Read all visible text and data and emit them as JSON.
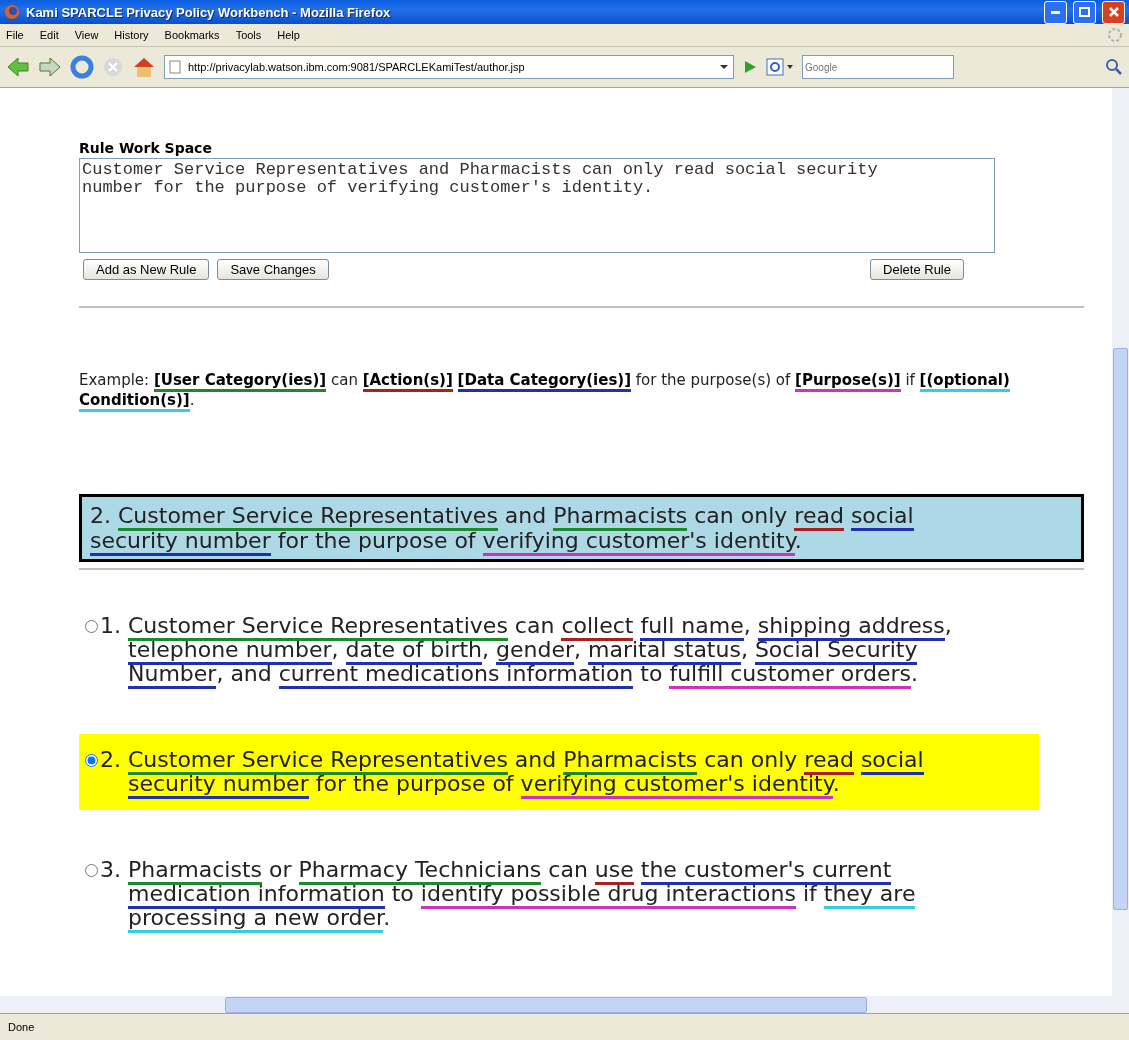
{
  "window": {
    "title": "Kami SPARCLE Privacy Policy Workbench - Mozilla Firefox"
  },
  "menu": [
    "File",
    "Edit",
    "View",
    "History",
    "Bookmarks",
    "Tools",
    "Help"
  ],
  "address": {
    "value": "http://privacylab.watson.ibm.com:9081/SPARCLEKamiTest/author.jsp"
  },
  "search": {
    "placeholder": "Google"
  },
  "workspace": {
    "label": "Rule Work Space",
    "value": "Customer Service Representatives and Pharmacists can only read social security number for the purpose of verifying customer's identity."
  },
  "buttons": [
    {
      "label": "Add as New Rule",
      "kind": "left"
    },
    {
      "label": "Save Changes",
      "kind": "left"
    },
    {
      "label": "Delete Rule",
      "kind": "right"
    }
  ],
  "example": [
    {
      "text": "Example: ",
      "kind": "plain"
    },
    {
      "text": "[User Category(ies)]",
      "kind": "user"
    },
    {
      "text": " can ",
      "kind": "plain"
    },
    {
      "text": "[Action(s)]",
      "kind": "action"
    },
    {
      "text": "[Data Category(ies)]",
      "kind": "data"
    },
    {
      "text": " for the purpose(s) of ",
      "kind": "plain"
    },
    {
      "text": "[Purpose(s)]",
      "kind": "purpose"
    },
    {
      "text": " if ",
      "kind": "plain"
    },
    {
      "text": "[(optional) Condition(s)]",
      "kind": "condition"
    },
    {
      "text": ".",
      "kind": "plain"
    }
  ],
  "current_rule": {
    "number": "2.",
    "segments": [
      {
        "text": "Customer Service Representatives",
        "kind": "user"
      },
      {
        "text": " and ",
        "kind": "plain"
      },
      {
        "text": "Pharmacists",
        "kind": "user"
      },
      {
        "text": " can only ",
        "kind": "plain"
      },
      {
        "text": "read",
        "kind": "action"
      },
      {
        "text": "social security number",
        "kind": "data"
      },
      {
        "text": " for the purpose of ",
        "kind": "plain"
      },
      {
        "text": "verifying customer's identity",
        "kind": "purpose"
      },
      {
        "text": ".",
        "kind": "plain"
      }
    ]
  },
  "rules": [
    {
      "number": "1.",
      "selected": false,
      "segments": [
        {
          "text": "Customer Service Representatives",
          "kind": "user"
        },
        {
          "text": " can ",
          "kind": "plain"
        },
        {
          "text": "collect",
          "kind": "action"
        },
        {
          "text": "full name",
          "kind": "data"
        },
        {
          "text": ", ",
          "kind": "plain"
        },
        {
          "text": "shipping address",
          "kind": "data"
        },
        {
          "text": ", ",
          "kind": "plain"
        },
        {
          "text": "telephone number",
          "kind": "data"
        },
        {
          "text": ", ",
          "kind": "plain"
        },
        {
          "text": "date of birth",
          "kind": "data"
        },
        {
          "text": ", ",
          "kind": "plain"
        },
        {
          "text": "gender",
          "kind": "data"
        },
        {
          "text": ", ",
          "kind": "plain"
        },
        {
          "text": "marital status",
          "kind": "data"
        },
        {
          "text": ", ",
          "kind": "plain"
        },
        {
          "text": "Social Security Number",
          "kind": "data"
        },
        {
          "text": ", and ",
          "kind": "plain"
        },
        {
          "text": "current medications information",
          "kind": "data"
        },
        {
          "text": " to ",
          "kind": "plain"
        },
        {
          "text": "fulfill customer orders",
          "kind": "purpose"
        },
        {
          "text": ".",
          "kind": "plain"
        }
      ]
    },
    {
      "number": "2.",
      "selected": true,
      "segments": [
        {
          "text": "Customer Service Representatives",
          "kind": "user"
        },
        {
          "text": " and ",
          "kind": "plain"
        },
        {
          "text": "Pharmacists",
          "kind": "user"
        },
        {
          "text": " can only ",
          "kind": "plain"
        },
        {
          "text": "read",
          "kind": "action"
        },
        {
          "text": "social security number",
          "kind": "data"
        },
        {
          "text": " for the purpose of ",
          "kind": "plain"
        },
        {
          "text": "verifying customer's identity",
          "kind": "purpose"
        },
        {
          "text": ".",
          "kind": "plain"
        }
      ]
    },
    {
      "number": "3.",
      "selected": false,
      "segments": [
        {
          "text": "Pharmacists",
          "kind": "user"
        },
        {
          "text": " or ",
          "kind": "plain"
        },
        {
          "text": "Pharmacy Technicians",
          "kind": "user"
        },
        {
          "text": " can ",
          "kind": "plain"
        },
        {
          "text": "use",
          "kind": "action"
        },
        {
          "text": "the customer's current medication information",
          "kind": "data"
        },
        {
          "text": " to ",
          "kind": "plain"
        },
        {
          "text": "identify possible drug interactions",
          "kind": "purpose"
        },
        {
          "text": " if ",
          "kind": "plain"
        },
        {
          "text": "they are processing a new order",
          "kind": "condition"
        },
        {
          "text": ".",
          "kind": "plain"
        }
      ]
    }
  ],
  "status_bar": {
    "text": "Done"
  }
}
